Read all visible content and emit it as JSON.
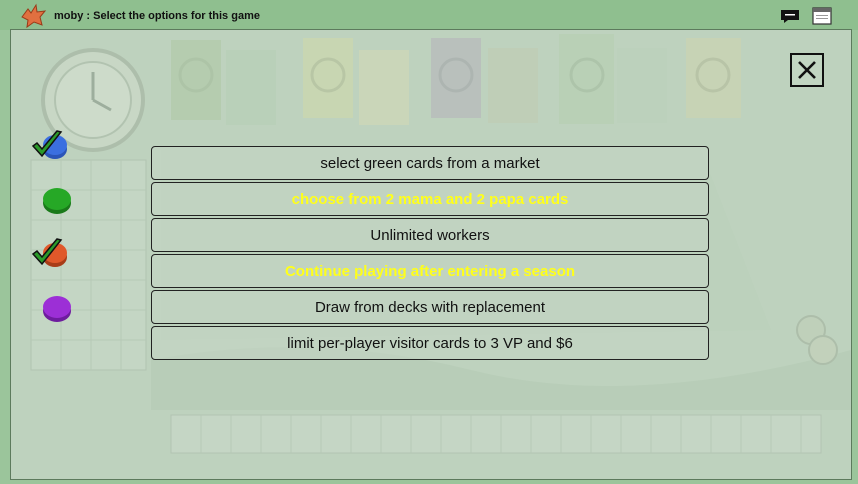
{
  "titlebar": {
    "title": "moby : Select the options for this game",
    "icons": [
      "bird-icon",
      "chat-icon",
      "window-icon"
    ]
  },
  "dialog": {
    "close_icon": "close-icon",
    "options": [
      {
        "label": "select green cards from a market",
        "highlighted": false
      },
      {
        "label": "choose from 2 mama and 2 papa cards",
        "highlighted": true
      },
      {
        "label": "Unlimited workers",
        "highlighted": false
      },
      {
        "label": "Continue playing after entering a season",
        "highlighted": true
      },
      {
        "label": "Draw from decks with replacement",
        "highlighted": false
      },
      {
        "label": "limit per-player visitor cards to 3 VP and $6",
        "highlighted": false
      }
    ]
  },
  "players": [
    {
      "color": "blue",
      "hex": "#3b6fe0",
      "checked": true
    },
    {
      "color": "green",
      "hex": "#26a826",
      "checked": false
    },
    {
      "color": "orange",
      "hex": "#e0582a",
      "checked": true
    },
    {
      "color": "purple",
      "hex": "#9c2fd6",
      "checked": false
    }
  ],
  "colors": {
    "highlight_text": "#ffff1a",
    "background": "#9bc59b"
  }
}
